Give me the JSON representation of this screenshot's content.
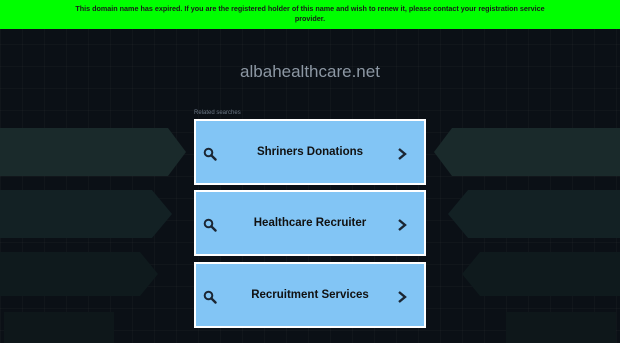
{
  "banner": {
    "text": "This domain name has expired. If you are the registered holder of this name and wish to renew it, please contact your registration service provider."
  },
  "site": {
    "domain": "albahealthcare.net"
  },
  "related": {
    "label": "Related searches",
    "items": [
      {
        "label": "Shriners Donations"
      },
      {
        "label": "Healthcare Recruiter"
      },
      {
        "label": "Recruitment Services"
      }
    ]
  },
  "colors": {
    "banner": "#00ff00",
    "background": "#0b1016",
    "card": "#82c5f5",
    "card_border": "#ffffff"
  }
}
